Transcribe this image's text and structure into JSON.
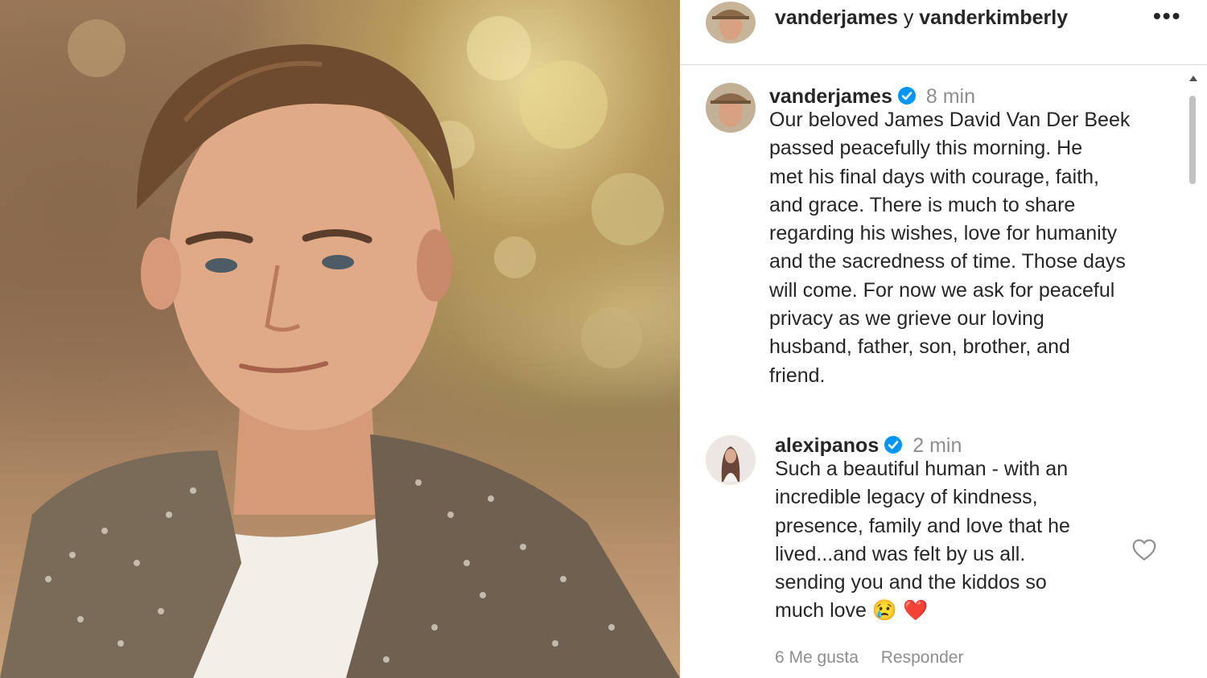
{
  "header": {
    "user1": "vanderjames",
    "joiner": "y",
    "user2": "vanderkimberly",
    "more_icon": "more-horizontal-icon"
  },
  "post": {
    "username": "vanderjames",
    "time": "8 min",
    "caption_lines": [
      "Our beloved James David Van Der Beek",
      "passed peacefully this morning.  He",
      "met his final days with courage, faith,",
      "and grace.  There is much to share",
      "regarding his wishes, love for humanity",
      "and the sacredness of time.  Those days",
      "will come.  For now we ask for peaceful",
      "privacy as we grieve our loving",
      "husband, father, son, brother, and",
      "friend."
    ]
  },
  "comment": {
    "username": "alexipanos",
    "time": "2 min",
    "lines": [
      "Such a beautiful human - with an",
      "incredible legacy of kindness,",
      "presence, family and love that he",
      "lived...and was felt by us all.",
      "sending you and the kiddos so",
      "much love"
    ],
    "emojis": [
      "😢",
      "❤️"
    ],
    "likes": "6 Me gusta",
    "reply": "Responder"
  },
  "colors": {
    "verified": "#0095f6",
    "heart": "#e0121d",
    "muted_text": "#8e8e8e"
  }
}
